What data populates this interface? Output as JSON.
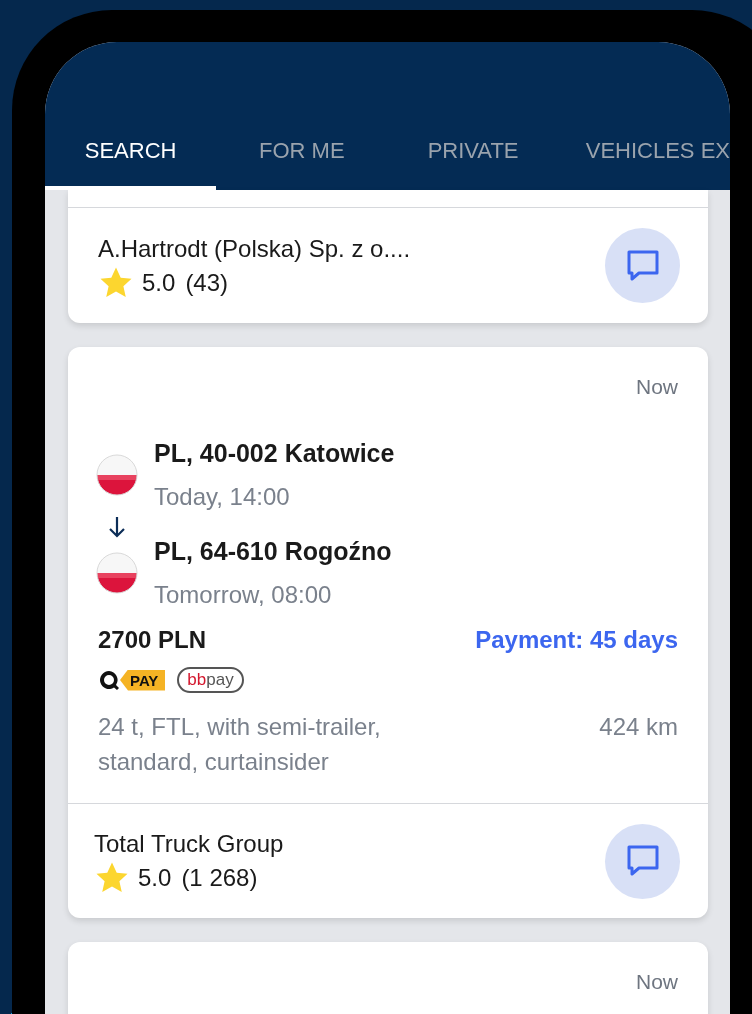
{
  "tabs": [
    {
      "label": "SEARCH",
      "selected": true
    },
    {
      "label": "FOR ME",
      "selected": false
    },
    {
      "label": "PRIVATE",
      "selected": false
    },
    {
      "label": "VEHICLES EX",
      "selected": false
    }
  ],
  "cards": [
    {
      "company": {
        "name": "A.Hartrodt (Polska) Sp. z o....",
        "rating": "5.0",
        "reviews": "(43)"
      }
    },
    {
      "time": "Now",
      "stops": [
        {
          "place": "PL, 40-002 Katowice",
          "when": "Today, 14:00"
        },
        {
          "place": "PL, 64-610 Rogoźno",
          "when": "Tomorrow, 08:00"
        }
      ],
      "price": "2700 PLN",
      "payment": "Payment: 45 days",
      "pay_methods": [
        {
          "kind": "qpay",
          "label": "PAY"
        },
        {
          "kind": "bbpay",
          "brand": "bb",
          "suffix": "pay"
        }
      ],
      "details": "24 t, FTL, with semi-trailer, standard, curtainsider",
      "distance": "424 km",
      "company": {
        "name": "Total Truck Group",
        "rating": "5.0",
        "reviews": "(1 268)"
      }
    },
    {
      "time": "Now"
    }
  ]
}
